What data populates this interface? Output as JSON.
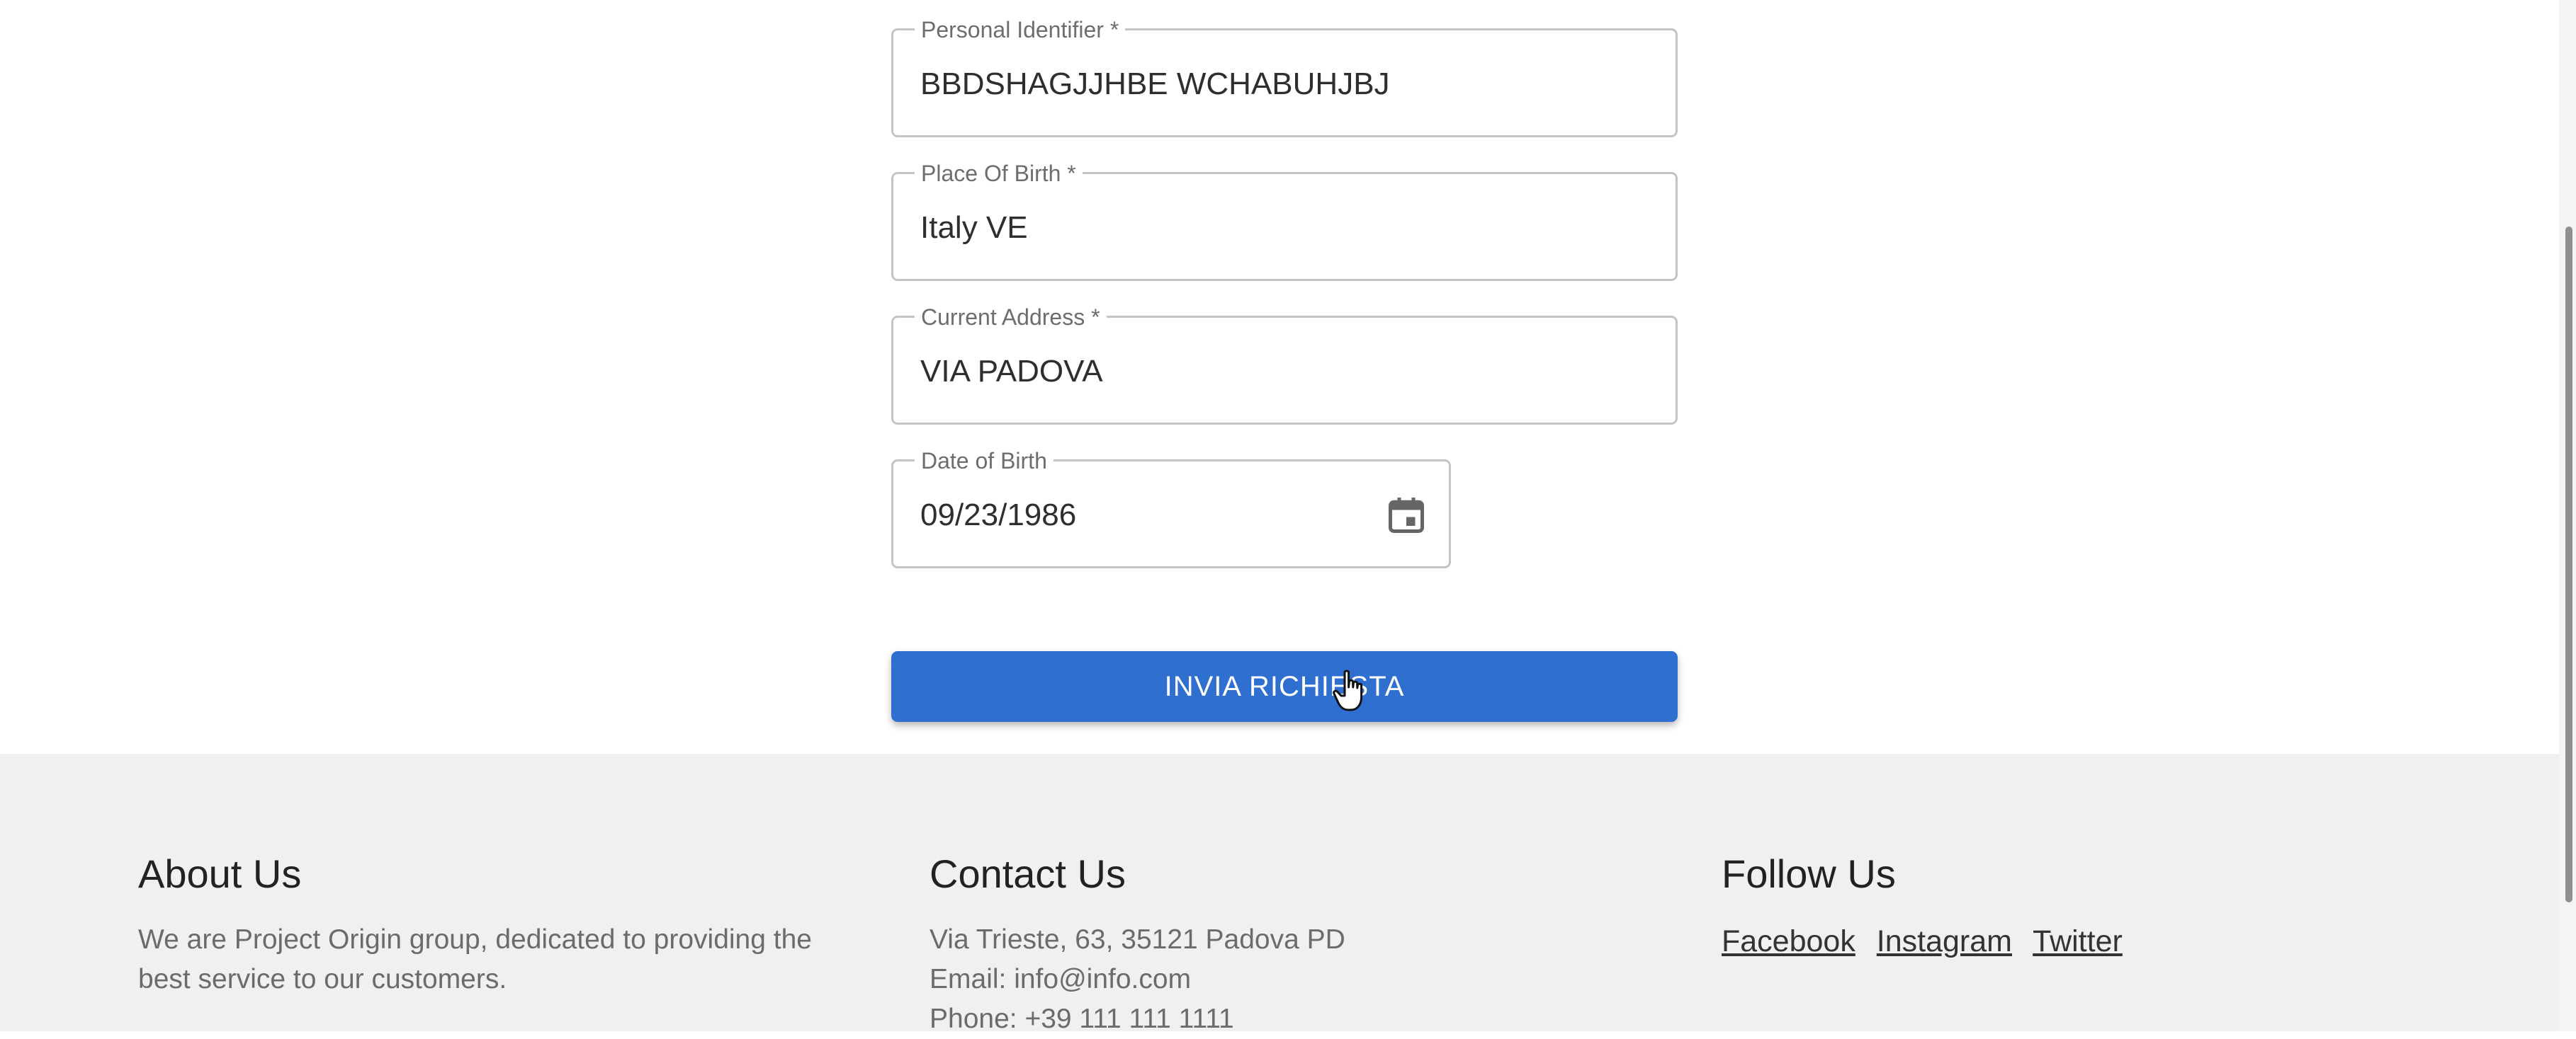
{
  "form": {
    "fields": [
      {
        "label": "Personal Identifier *",
        "value": "BBDSHAGJJHBE WCHABUHJBJ"
      },
      {
        "label": "Place Of Birth *",
        "value": "Italy VE"
      },
      {
        "label": "Current Address *",
        "value": "VIA PADOVA"
      },
      {
        "label": "Date of Birth",
        "value": "09/23/1986",
        "icon": "calendar-icon"
      }
    ],
    "submit_label": "INVIA RICHIESTA"
  },
  "footer": {
    "about": {
      "title": "About Us",
      "text": "We are Project Origin group, dedicated to providing the best service to our customers."
    },
    "contact": {
      "title": "Contact Us",
      "address": "Via Trieste, 63, 35121 Padova PD",
      "email": "Email: info@info.com",
      "phone": "Phone: +39 111 111 1111"
    },
    "follow": {
      "title": "Follow Us",
      "links": [
        "Facebook",
        "Instagram",
        "Twitter"
      ]
    }
  },
  "colors": {
    "primary_button": "#2f6fcf",
    "footer_background": "#f0f0f0",
    "field_border": "#c4c4c4"
  }
}
